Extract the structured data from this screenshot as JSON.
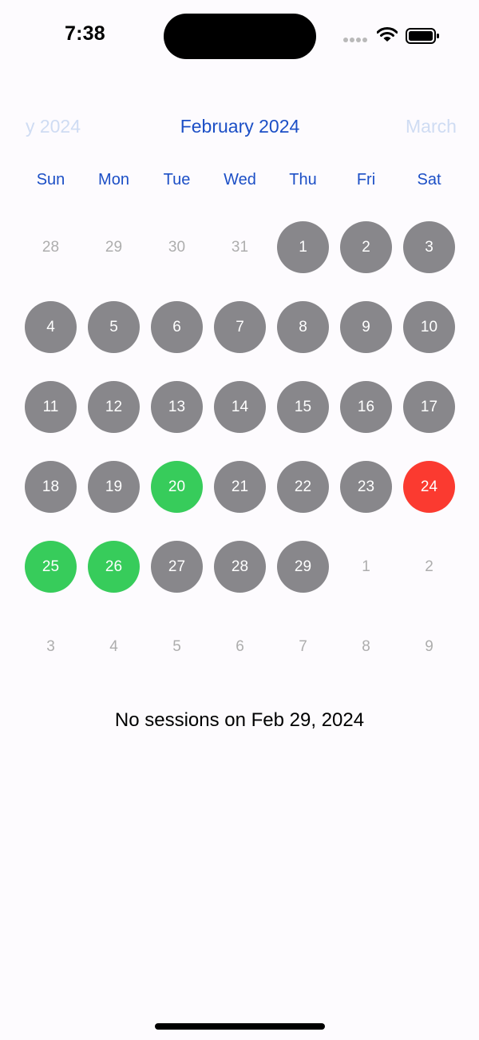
{
  "status_bar": {
    "time": "7:38"
  },
  "calendar": {
    "prev_month_label": "y 2024",
    "current_month_label": "February 2024",
    "next_month_label": "March",
    "weekdays": [
      "Sun",
      "Mon",
      "Tue",
      "Wed",
      "Thu",
      "Fri",
      "Sat"
    ],
    "colors": {
      "accent": "#1c4fc6",
      "no_session": "#88878b",
      "good_session": "#37cc5b",
      "bad_session": "#fb3a30",
      "outside_month": "#adadad"
    },
    "weeks": [
      [
        {
          "label": "28",
          "status": "outside"
        },
        {
          "label": "29",
          "status": "outside"
        },
        {
          "label": "30",
          "status": "outside"
        },
        {
          "label": "31",
          "status": "outside"
        },
        {
          "label": "1",
          "status": "none"
        },
        {
          "label": "2",
          "status": "none"
        },
        {
          "label": "3",
          "status": "none"
        }
      ],
      [
        {
          "label": "4",
          "status": "none"
        },
        {
          "label": "5",
          "status": "none"
        },
        {
          "label": "6",
          "status": "none"
        },
        {
          "label": "7",
          "status": "none"
        },
        {
          "label": "8",
          "status": "none"
        },
        {
          "label": "9",
          "status": "none"
        },
        {
          "label": "10",
          "status": "none"
        }
      ],
      [
        {
          "label": "11",
          "status": "none"
        },
        {
          "label": "12",
          "status": "none"
        },
        {
          "label": "13",
          "status": "none"
        },
        {
          "label": "14",
          "status": "none"
        },
        {
          "label": "15",
          "status": "none"
        },
        {
          "label": "16",
          "status": "none"
        },
        {
          "label": "17",
          "status": "none"
        }
      ],
      [
        {
          "label": "18",
          "status": "none"
        },
        {
          "label": "19",
          "status": "none"
        },
        {
          "label": "20",
          "status": "good"
        },
        {
          "label": "21",
          "status": "none"
        },
        {
          "label": "22",
          "status": "none"
        },
        {
          "label": "23",
          "status": "none"
        },
        {
          "label": "24",
          "status": "bad"
        }
      ],
      [
        {
          "label": "25",
          "status": "good"
        },
        {
          "label": "26",
          "status": "good"
        },
        {
          "label": "27",
          "status": "none"
        },
        {
          "label": "28",
          "status": "none"
        },
        {
          "label": "29",
          "status": "none"
        },
        {
          "label": "1",
          "status": "outside"
        },
        {
          "label": "2",
          "status": "outside"
        }
      ],
      [
        {
          "label": "3",
          "status": "outside"
        },
        {
          "label": "4",
          "status": "outside"
        },
        {
          "label": "5",
          "status": "outside"
        },
        {
          "label": "6",
          "status": "outside"
        },
        {
          "label": "7",
          "status": "outside"
        },
        {
          "label": "8",
          "status": "outside"
        },
        {
          "label": "9",
          "status": "outside"
        }
      ]
    ]
  },
  "message": {
    "text": "No sessions on Feb 29, 2024"
  }
}
